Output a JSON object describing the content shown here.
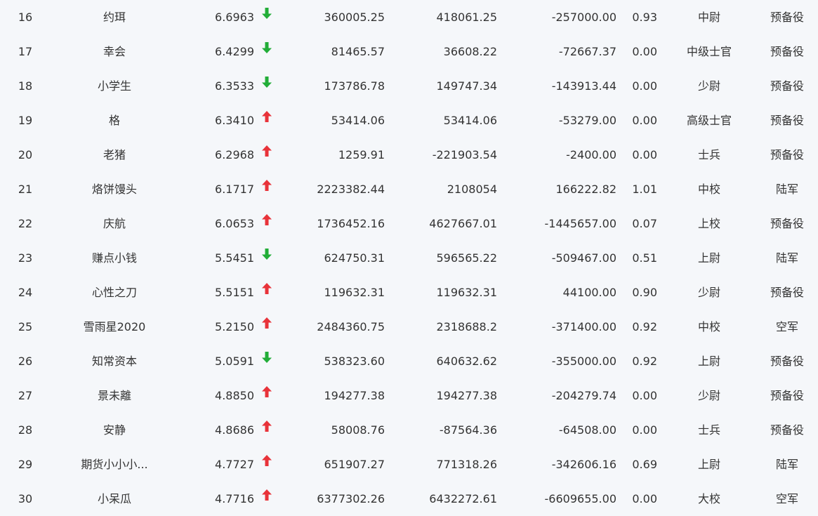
{
  "colors": {
    "up": "#e8333a",
    "down": "#22ad38",
    "background": "#f5f7fa",
    "text": "#333333"
  },
  "rows": [
    {
      "rank": "16",
      "name": "约珥",
      "score": "6.6963",
      "trend": "down",
      "v1": "360005.25",
      "v2": "418061.25",
      "v3": "-257000.00",
      "ratio": "0.93",
      "title": "中尉",
      "unit": "预备役"
    },
    {
      "rank": "17",
      "name": "幸会",
      "score": "6.4299",
      "trend": "down",
      "v1": "81465.57",
      "v2": "36608.22",
      "v3": "-72667.37",
      "ratio": "0.00",
      "title": "中级士官",
      "unit": "预备役"
    },
    {
      "rank": "18",
      "name": "小学生",
      "score": "6.3533",
      "trend": "down",
      "v1": "173786.78",
      "v2": "149747.34",
      "v3": "-143913.44",
      "ratio": "0.00",
      "title": "少尉",
      "unit": "预备役"
    },
    {
      "rank": "19",
      "name": "格",
      "score": "6.3410",
      "trend": "up",
      "v1": "53414.06",
      "v2": "53414.06",
      "v3": "-53279.00",
      "ratio": "0.00",
      "title": "高级士官",
      "unit": "预备役"
    },
    {
      "rank": "20",
      "name": "老猪",
      "score": "6.2968",
      "trend": "up",
      "v1": "1259.91",
      "v2": "-221903.54",
      "v3": "-2400.00",
      "ratio": "0.00",
      "title": "士兵",
      "unit": "预备役"
    },
    {
      "rank": "21",
      "name": "烙饼馒头",
      "score": "6.1717",
      "trend": "up",
      "v1": "2223382.44",
      "v2": "2108054",
      "v3": "166222.82",
      "ratio": "1.01",
      "title": "中校",
      "unit": "陆军"
    },
    {
      "rank": "22",
      "name": "庆航",
      "score": "6.0653",
      "trend": "up",
      "v1": "1736452.16",
      "v2": "4627667.01",
      "v3": "-1445657.00",
      "ratio": "0.07",
      "title": "上校",
      "unit": "预备役"
    },
    {
      "rank": "23",
      "name": "赚点小钱",
      "score": "5.5451",
      "trend": "down",
      "v1": "624750.31",
      "v2": "596565.22",
      "v3": "-509467.00",
      "ratio": "0.51",
      "title": "上尉",
      "unit": "陆军"
    },
    {
      "rank": "24",
      "name": "心性之刀",
      "score": "5.5151",
      "trend": "up",
      "v1": "119632.31",
      "v2": "119632.31",
      "v3": "44100.00",
      "ratio": "0.90",
      "title": "少尉",
      "unit": "预备役"
    },
    {
      "rank": "25",
      "name": "雪雨星2020",
      "score": "5.2150",
      "trend": "up",
      "v1": "2484360.75",
      "v2": "2318688.2",
      "v3": "-371400.00",
      "ratio": "0.92",
      "title": "中校",
      "unit": "空军"
    },
    {
      "rank": "26",
      "name": "知常资本",
      "score": "5.0591",
      "trend": "down",
      "v1": "538323.60",
      "v2": "640632.62",
      "v3": "-355000.00",
      "ratio": "0.92",
      "title": "上尉",
      "unit": "预备役"
    },
    {
      "rank": "27",
      "name": "景未離",
      "score": "4.8850",
      "trend": "up",
      "v1": "194277.38",
      "v2": "194277.38",
      "v3": "-204279.74",
      "ratio": "0.00",
      "title": "少尉",
      "unit": "预备役"
    },
    {
      "rank": "28",
      "name": "安静",
      "score": "4.8686",
      "trend": "up",
      "v1": "58008.76",
      "v2": "-87564.36",
      "v3": "-64508.00",
      "ratio": "0.00",
      "title": "士兵",
      "unit": "预备役"
    },
    {
      "rank": "29",
      "name": "期货小小小...",
      "score": "4.7727",
      "trend": "up",
      "v1": "651907.27",
      "v2": "771318.26",
      "v3": "-342606.16",
      "ratio": "0.69",
      "title": "上尉",
      "unit": "陆军"
    },
    {
      "rank": "30",
      "name": "小呆瓜",
      "score": "4.7716",
      "trend": "up",
      "v1": "6377302.26",
      "v2": "6432272.61",
      "v3": "-6609655.00",
      "ratio": "0.00",
      "title": "大校",
      "unit": "空军"
    }
  ]
}
